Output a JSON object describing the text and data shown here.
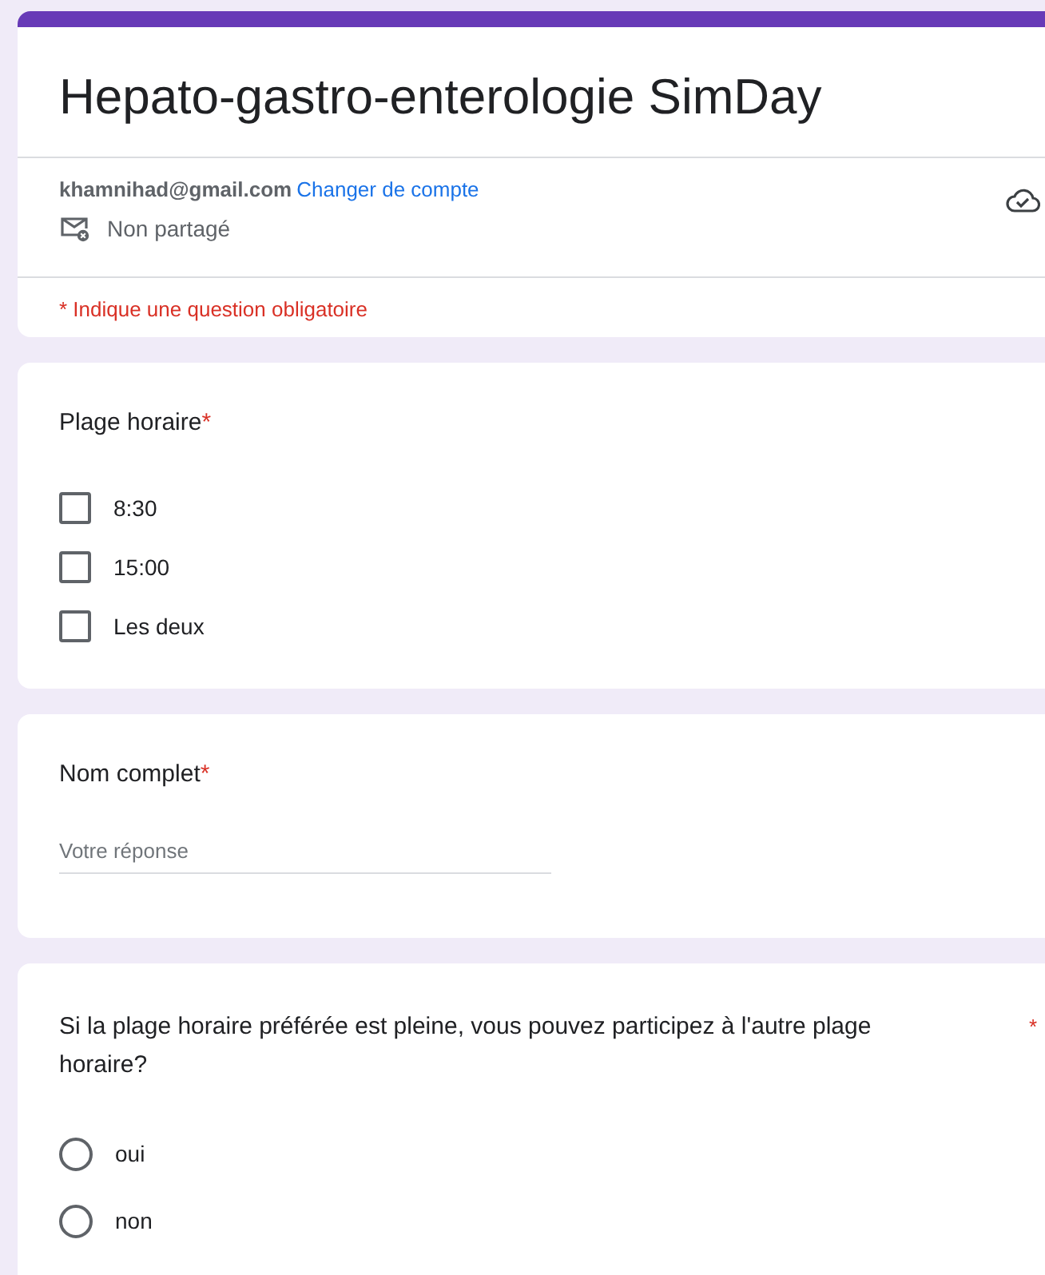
{
  "form": {
    "title": "Hepato-gastro-enterologie SimDay",
    "account_email": "khamnihad@gmail.com",
    "switch_account_link": "Changer de compte",
    "sharing_status": "Non partagé",
    "saved_to_cloud": true,
    "required_notice": "* Indique une question obligatoire"
  },
  "questions": [
    {
      "kind": "checkbox",
      "title": "Plage horaire",
      "required": true,
      "required_mark": "*",
      "options": [
        {
          "label": "8:30",
          "checked": false
        },
        {
          "label": "15:00",
          "checked": false
        },
        {
          "label": "Les deux",
          "checked": false
        }
      ]
    },
    {
      "kind": "text",
      "title": "Nom complet",
      "required": true,
      "required_mark": "*",
      "placeholder": "Votre réponse"
    },
    {
      "kind": "radio",
      "title": "Si la plage horaire préférée est pleine, vous pouvez participez à l'autre plage horaire?",
      "required": true,
      "required_mark": "*",
      "options": [
        {
          "label": "oui",
          "selected": false
        },
        {
          "label": "non",
          "selected": false
        }
      ]
    }
  ]
}
